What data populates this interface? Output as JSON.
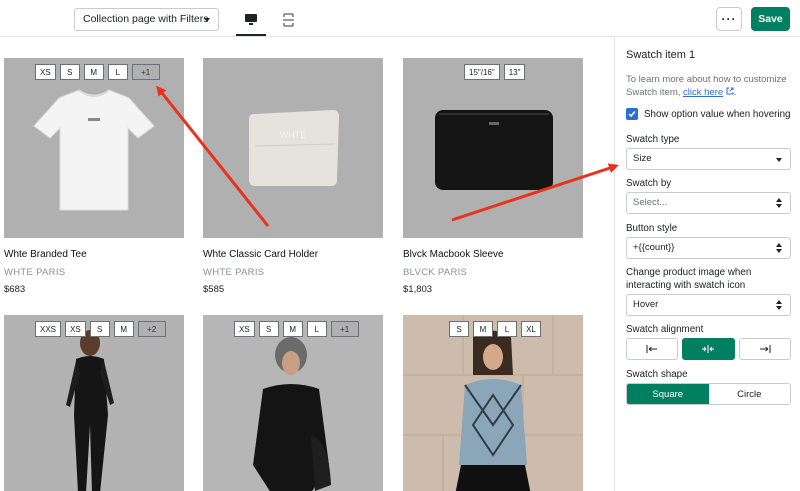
{
  "topbar": {
    "template_value": "Collection page with Filters",
    "more_label": "···",
    "save_label": "Save"
  },
  "products": [
    {
      "name": "Whte Branded Tee",
      "vendor": "WHTE PARIS",
      "price": "$683",
      "swatches": [
        "XS",
        "S",
        "M",
        "L"
      ],
      "more": "+1",
      "image": "white t-shirt"
    },
    {
      "name": "Whte Classic Card Holder",
      "vendor": "WHTE PARIS",
      "price": "$585",
      "swatches": [],
      "more": "",
      "image": "white card holder"
    },
    {
      "name": "Blvck Macbook Sleeve",
      "vendor": "BLVCK PARIS",
      "price": "$1,803",
      "swatches": [
        "15\"/16\"",
        "13\""
      ],
      "more": "",
      "image": "black laptop sleeve"
    },
    {
      "name": "",
      "vendor": "",
      "price": "",
      "swatches": [
        "XXS",
        "XS",
        "S",
        "M"
      ],
      "more": "+2",
      "image": "model in black outfit"
    },
    {
      "name": "",
      "vendor": "",
      "price": "",
      "swatches": [
        "XS",
        "S",
        "M",
        "L"
      ],
      "more": "+1",
      "image": "model in black hoodie"
    },
    {
      "name": "",
      "vendor": "",
      "price": "",
      "swatches": [
        "S",
        "M",
        "L",
        "XL"
      ],
      "more": "",
      "image": "model in argyle vest"
    }
  ],
  "sidebar": {
    "title": "Swatch item 1",
    "help_text": "To learn more about how to customize Swatch item,",
    "help_link": "click here",
    "show_option_label": "Show option value when hovering",
    "show_option_checked": true,
    "swatch_type_label": "Swatch type",
    "swatch_type_value": "Size",
    "swatch_by_label": "Swatch by",
    "swatch_by_placeholder": "Select...",
    "button_style_label": "Button style",
    "button_style_value": "+{{count}}",
    "change_image_label": "Change product image when interacting with swatch icon",
    "change_image_value": "Hover",
    "alignment_label": "Swatch alignment",
    "alignment_options": [
      "left",
      "center",
      "right"
    ],
    "alignment_selected": "center",
    "shape_label": "Swatch shape",
    "shape_square": "Square",
    "shape_circle": "Circle",
    "shape_selected": "Square"
  },
  "colors": {
    "accent": "#008060",
    "link": "#2c6ecb",
    "annotation_arrow": "#e8321e",
    "image_bg": "#b0b0b0"
  }
}
